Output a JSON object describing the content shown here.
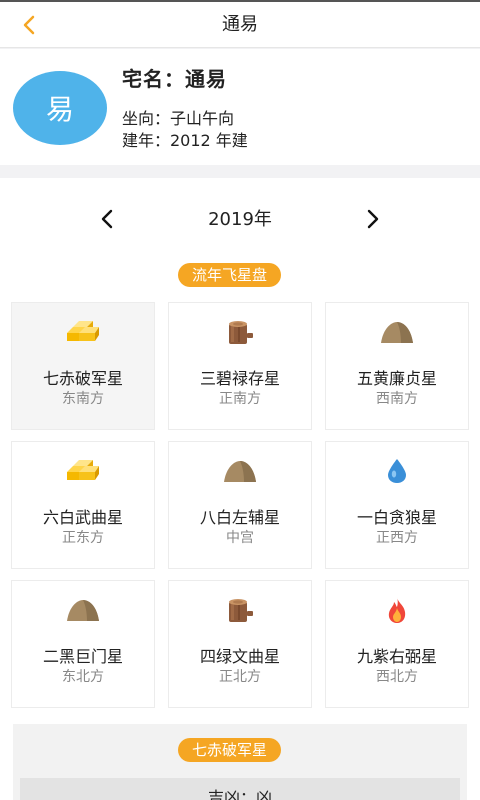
{
  "nav": {
    "title": "通易",
    "back_icon": "chevron-left-icon",
    "accent": "#f5a623"
  },
  "house": {
    "avatar_char": "易",
    "name": "宅名：通易",
    "facing": "坐向：子山午向",
    "year_built": "建年：2012 年建",
    "avatar_color": "#4fb3ea"
  },
  "year_nav": {
    "label": "2019年",
    "prev_icon": "chevron-left-icon",
    "next_icon": "chevron-right-icon"
  },
  "section_title": "流年飞星盘",
  "cells": [
    {
      "star": "七赤破军星",
      "direction": "东南方",
      "icon": "gold-icon",
      "selected": true
    },
    {
      "star": "三碧禄存星",
      "direction": "正南方",
      "icon": "wood-icon",
      "selected": false
    },
    {
      "star": "五黄廉贞星",
      "direction": "西南方",
      "icon": "earth-icon",
      "selected": false
    },
    {
      "star": "六白武曲星",
      "direction": "正东方",
      "icon": "gold-icon",
      "selected": false
    },
    {
      "star": "八白左辅星",
      "direction": "中宫",
      "icon": "earth-icon",
      "selected": false
    },
    {
      "star": "一白贪狼星",
      "direction": "正西方",
      "icon": "water-icon",
      "selected": false
    },
    {
      "star": "二黑巨门星",
      "direction": "东北方",
      "icon": "earth-icon",
      "selected": false
    },
    {
      "star": "四绿文曲星",
      "direction": "正北方",
      "icon": "wood-icon",
      "selected": false
    },
    {
      "star": "九紫右弼星",
      "direction": "西北方",
      "icon": "fire-icon",
      "selected": false
    }
  ],
  "detail": {
    "title": "七赤破军星",
    "text": "吉凶：凶"
  }
}
